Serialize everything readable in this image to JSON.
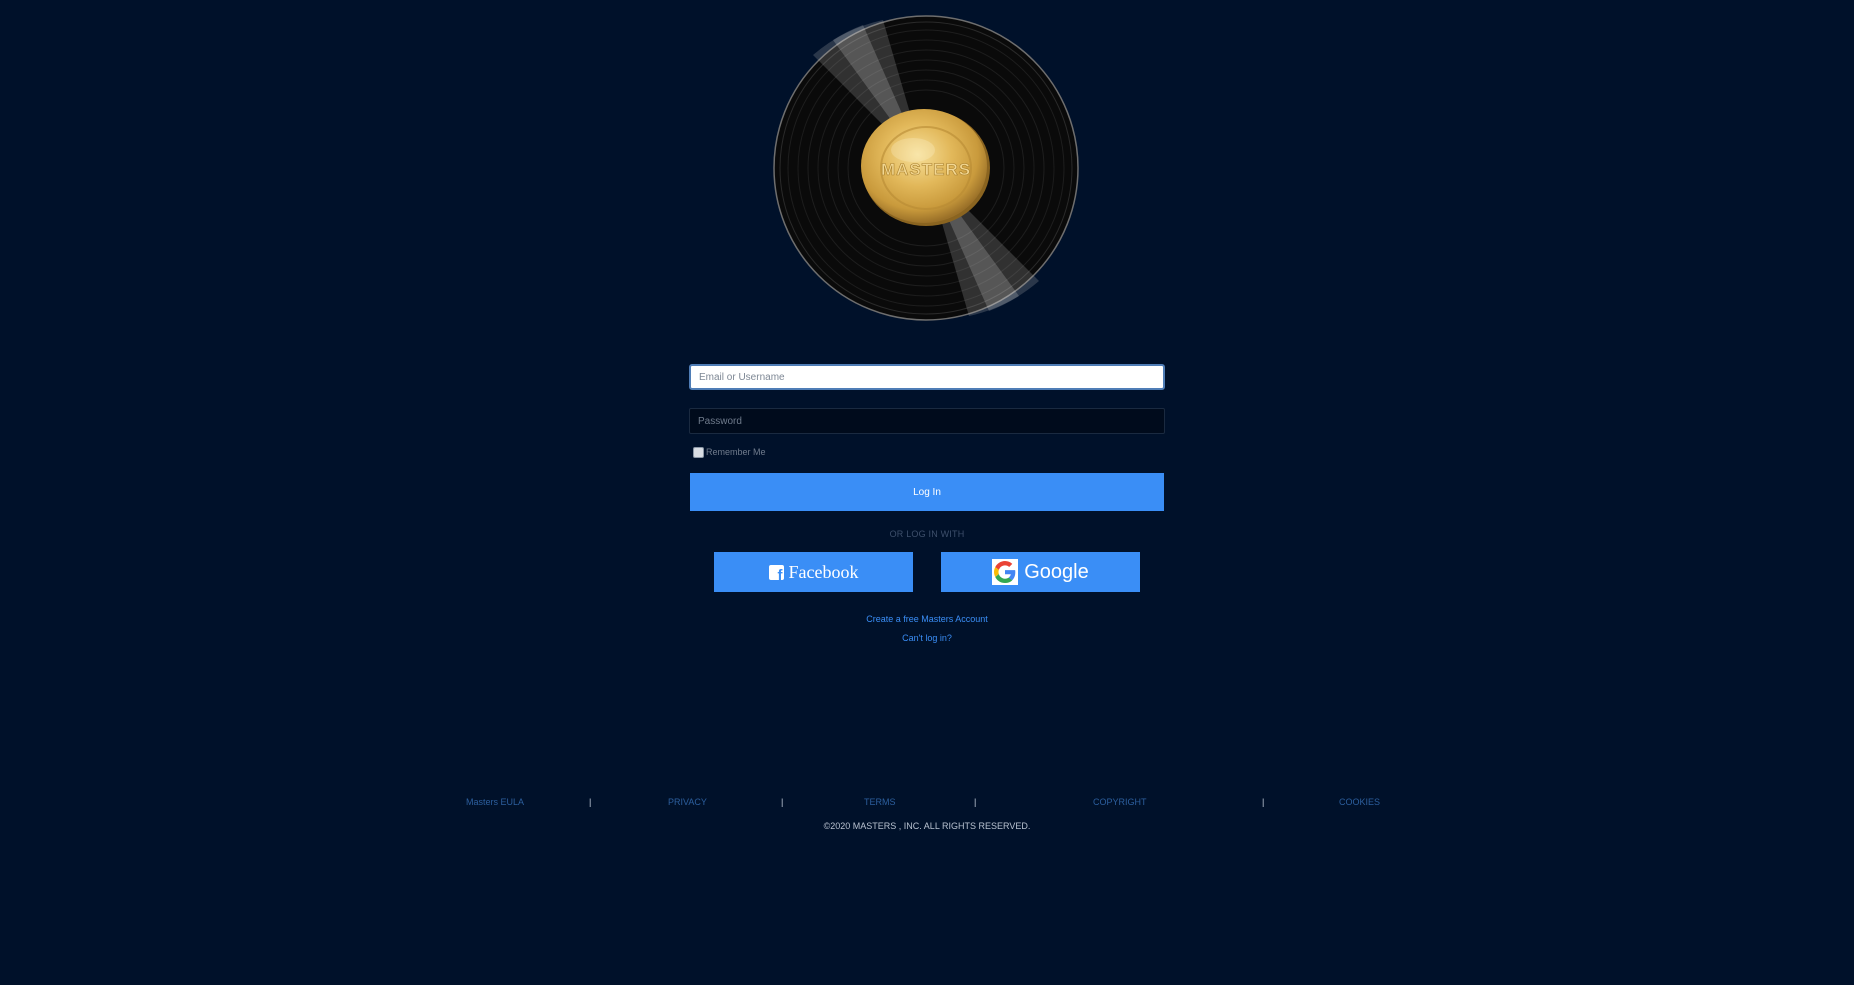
{
  "logo": {
    "label": "MASTERS"
  },
  "login_form": {
    "email_placeholder": "Email or Username",
    "password_placeholder": "Password",
    "remember_label": "Remember Me",
    "login_label": "Log In",
    "or_text": "OR LOG IN WITH"
  },
  "social": {
    "facebook_label": "Facebook",
    "google_label": "Google"
  },
  "links": {
    "create_account": "Create a free Masters Account",
    "cant_login": "Can't log in?"
  },
  "footer": {
    "eula": "Masters EULA",
    "privacy": "PRIVACY",
    "terms": "TERMS",
    "copyright_link": "COPYRIGHT",
    "cookies": "COOKIES",
    "separator": "|",
    "copyright_text": "©2020 MASTERS , INC. ALL RIGHTS RESERVED."
  },
  "colors": {
    "background": "#00112a",
    "accent": "#3a8ef6",
    "footer_link": "#2c5f9e"
  }
}
